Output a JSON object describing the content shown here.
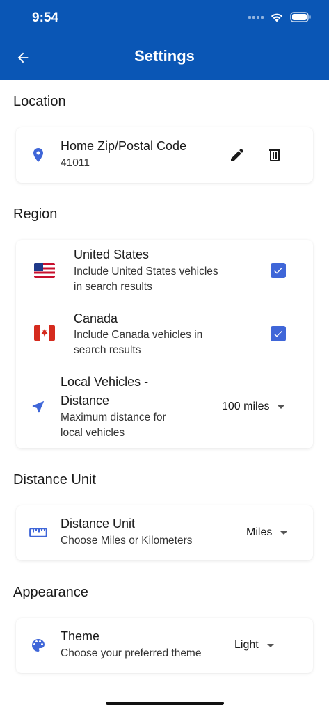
{
  "status_bar": {
    "time": "9:54"
  },
  "app_bar": {
    "title": "Settings"
  },
  "location": {
    "section_title": "Location",
    "home_zip": {
      "title": "Home Zip/Postal Code",
      "value": "41011"
    }
  },
  "region": {
    "section_title": "Region",
    "united_states": {
      "title": "United States",
      "subtitle_line1": "Include United States vehicles",
      "subtitle_line2": "in search results",
      "checked": true
    },
    "canada": {
      "title": "Canada",
      "subtitle_line1": "Include Canada vehicles in",
      "subtitle_line2": "search results",
      "checked": true
    },
    "local_vehicles": {
      "title_line1": "Local Vehicles -",
      "title_line2": "Distance",
      "subtitle_line1": "Maximum distance for",
      "subtitle_line2": "local vehicles",
      "selected": "100 miles"
    }
  },
  "distance_unit": {
    "section_title": "Distance Unit",
    "title": "Distance Unit",
    "subtitle": "Choose Miles or Kilometers",
    "selected": "Miles"
  },
  "appearance": {
    "section_title": "Appearance",
    "title": "Theme",
    "subtitle": "Choose your preferred theme",
    "selected": "Light"
  },
  "colors": {
    "app_bar": "#0a56b5",
    "accent": "#3f66d8"
  }
}
